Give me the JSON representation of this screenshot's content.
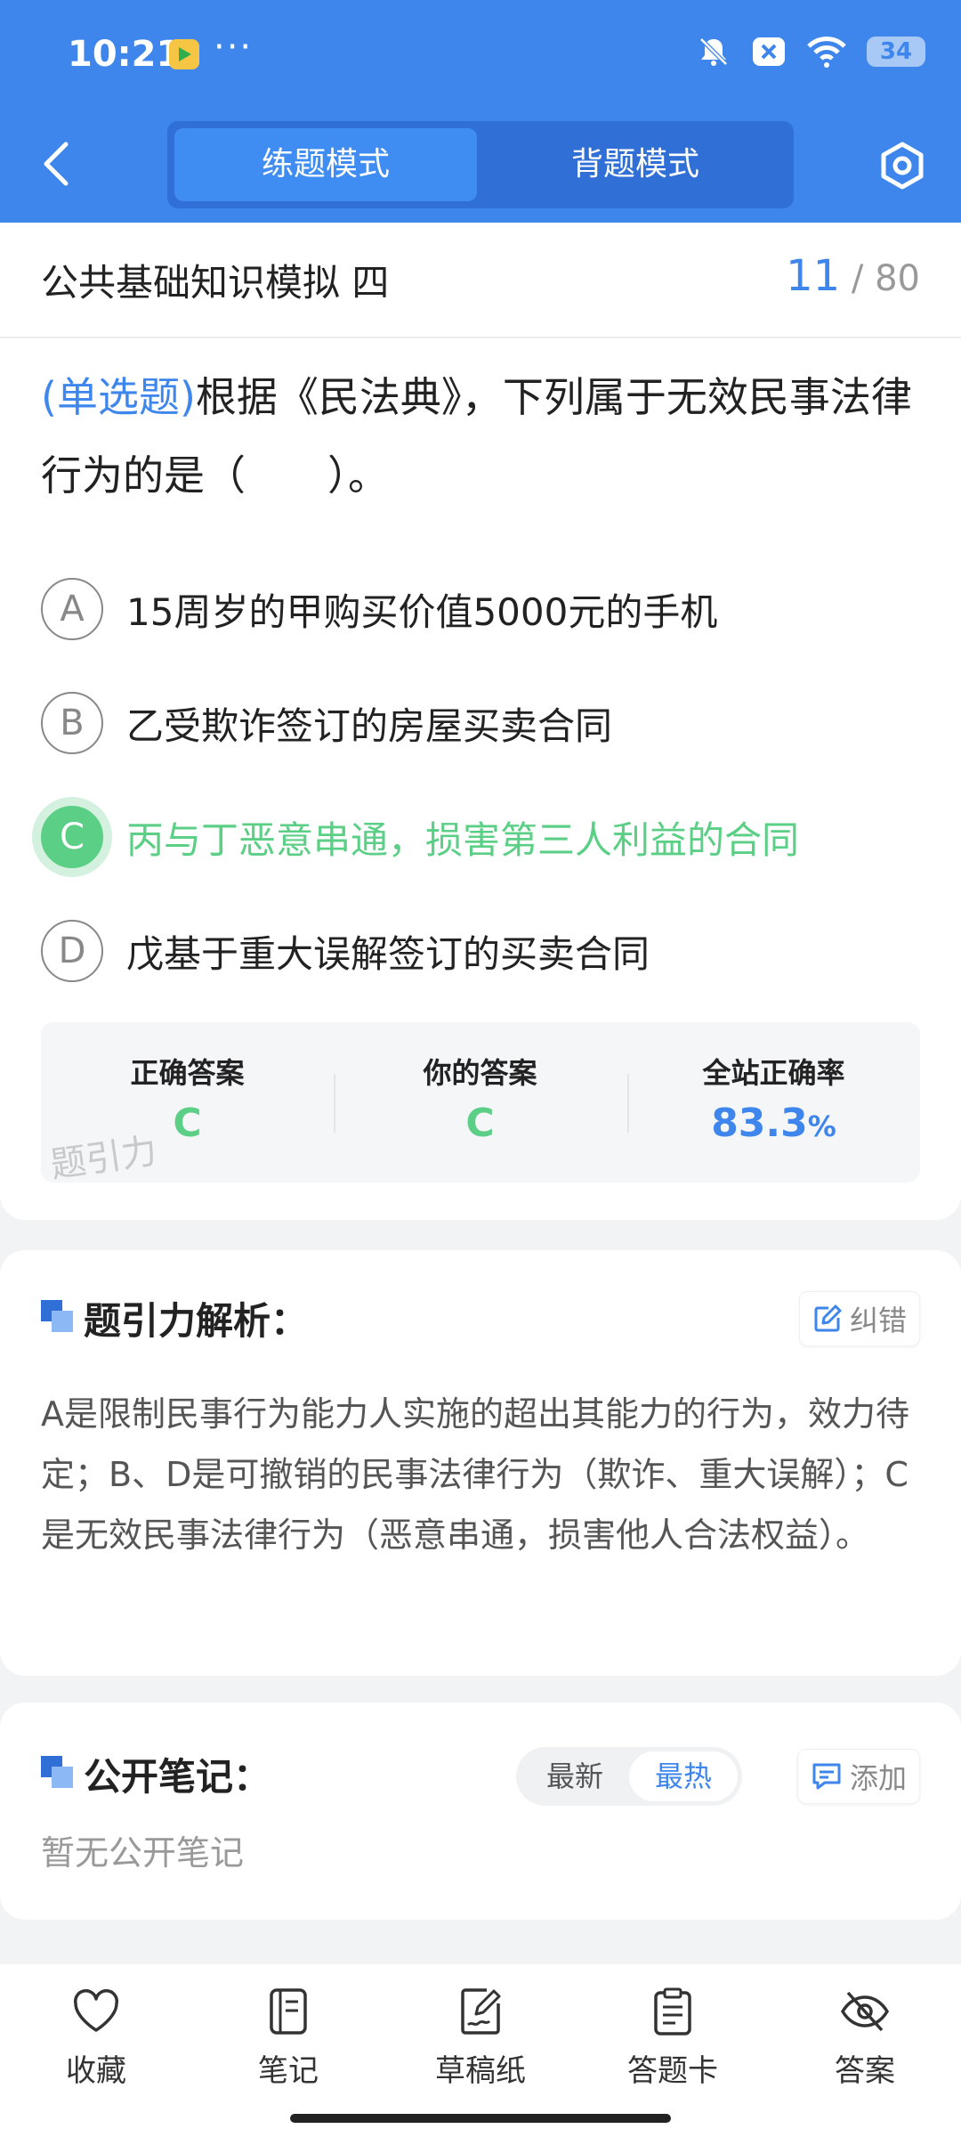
{
  "status_bar": {
    "time": "10:21",
    "dots": "···",
    "battery": "34"
  },
  "header": {
    "tabs": [
      {
        "label": "练题模式",
        "active": true
      },
      {
        "label": "背题模式",
        "active": false
      }
    ]
  },
  "question": {
    "paper_title": "公共基础知识模拟 四",
    "progress_current": "11",
    "progress_total": "/ 80",
    "type_label": "(单选题)",
    "stem": "根据《民法典》，下列属于无效民事法律行为的是（　　）。",
    "options": [
      {
        "letter": "A",
        "text": "15周岁的甲购买价值5000元的手机"
      },
      {
        "letter": "B",
        "text": "乙受欺诈签订的房屋买卖合同"
      },
      {
        "letter": "C",
        "text": "丙与丁恶意串通，损害第三人利益的合同"
      },
      {
        "letter": "D",
        "text": "戊基于重大误解签订的买卖合同"
      }
    ],
    "answer_summary": {
      "correct_label": "正确答案",
      "correct_value": "C",
      "yours_label": "你的答案",
      "yours_value": "C",
      "rate_label": "全站正确率",
      "rate_value": "83.3",
      "rate_unit": "%",
      "watermark": "题引力"
    }
  },
  "analysis": {
    "title": "题引力解析：",
    "report_label": "纠错",
    "text": "A是限制民事行为能力人实施的超出其能力的行为，效力待定；B、D是可撤销的民事法律行为（欺诈、重大误解）；C是无效民事法律行为（恶意串通，损害他人合法权益）。"
  },
  "notes": {
    "title": "公开笔记：",
    "sort_latest": "最新",
    "sort_hottest": "最热",
    "add_label": "添加",
    "empty_text": "暂无公开笔记"
  },
  "bottom_tabs": [
    {
      "label": "收藏",
      "icon": "heart-icon"
    },
    {
      "label": "笔记",
      "icon": "notebook-icon"
    },
    {
      "label": "草稿纸",
      "icon": "scratch-paper-icon"
    },
    {
      "label": "答题卡",
      "icon": "answer-card-icon"
    },
    {
      "label": "答案",
      "icon": "eye-off-icon"
    }
  ],
  "colors": {
    "accent": "#3e86ec",
    "correct": "#5ccf86"
  }
}
